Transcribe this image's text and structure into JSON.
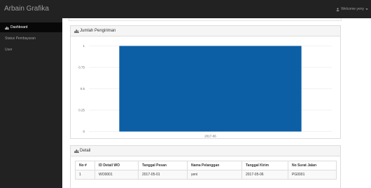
{
  "header": {
    "brand": "Arbain Grafika",
    "welcome": "Welcome yeny"
  },
  "sidebar": {
    "items": [
      {
        "label": "Dashboard",
        "active": true,
        "icon": "chart-icon"
      },
      {
        "label": "Status Pembayaran",
        "active": false
      },
      {
        "label": "User",
        "active": false
      }
    ]
  },
  "chart_panel": {
    "title": "Jumlah Pengiriman"
  },
  "chart_data": {
    "type": "bar",
    "categories": [
      "2017-06"
    ],
    "values": [
      1
    ],
    "ylim": [
      0,
      1
    ],
    "yticks": [
      "0",
      "0.25",
      "0.5",
      "0.75",
      "1"
    ],
    "grid": true,
    "bar_color": "#0c5fa5"
  },
  "detail_panel": {
    "title": "Detail",
    "columns": [
      "No #",
      "ID Detail WO",
      "Tanggal Pesan",
      "Nama Pelanggan",
      "Tanggal Kirim",
      "No Surat Jalan"
    ],
    "rows": [
      [
        "1",
        "WO0001",
        "2017-05-01",
        "yeni",
        "2017-05-06",
        "PG0001"
      ]
    ]
  }
}
